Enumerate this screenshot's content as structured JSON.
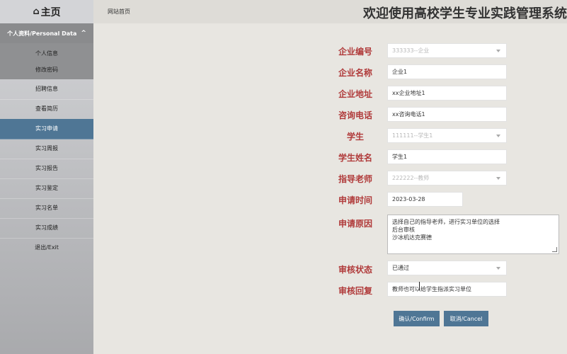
{
  "sidebar": {
    "home_icon": "⌂",
    "home_label": "主页",
    "group_label": "个人资料/Personal Data",
    "group_chevron": "^",
    "sub_items": [
      "个人信息",
      "修改密码"
    ],
    "items": [
      "招聘信息",
      "查看简历",
      "实习申请",
      "实习周报",
      "实习报告",
      "实习鉴定",
      "实习名单",
      "实习成绩",
      "退出/Exit"
    ],
    "active_index": 2
  },
  "header": {
    "breadcrumb": "网站首页",
    "title": "欢迎使用高校学生专业实践管理系统"
  },
  "form": {
    "company_no": {
      "label": "企业编号",
      "value": "333333--企业"
    },
    "company_name": {
      "label": "企业名称",
      "value": "企业1"
    },
    "company_address": {
      "label": "企业地址",
      "value": "xx企业地址1"
    },
    "phone": {
      "label": "咨询电话",
      "value": "xx咨询电话1"
    },
    "student": {
      "label": "学生",
      "value": "111111--学生1"
    },
    "student_name": {
      "label": "学生姓名",
      "value": "学生1"
    },
    "teacher": {
      "label": "指导老师",
      "value": "222222--教师"
    },
    "apply_date": {
      "label": "申请时间",
      "value": "2023-03-28"
    },
    "reason": {
      "label": "申请原因",
      "line1": "选择自己的指导老师，进行实习单位的选择",
      "line2": "后台审核",
      "line3": "沙冰机达克赛德"
    },
    "status": {
      "label": "审核状态",
      "value": "已通过"
    },
    "reply": {
      "label": "审核回复",
      "value": "教师也可以给学生指派实习单位"
    }
  },
  "buttons": {
    "confirm": "确认/Confirm",
    "cancel": "取消/Cancel"
  },
  "colors": {
    "accent": "#4f7695",
    "label_red": "#b03a3a"
  }
}
